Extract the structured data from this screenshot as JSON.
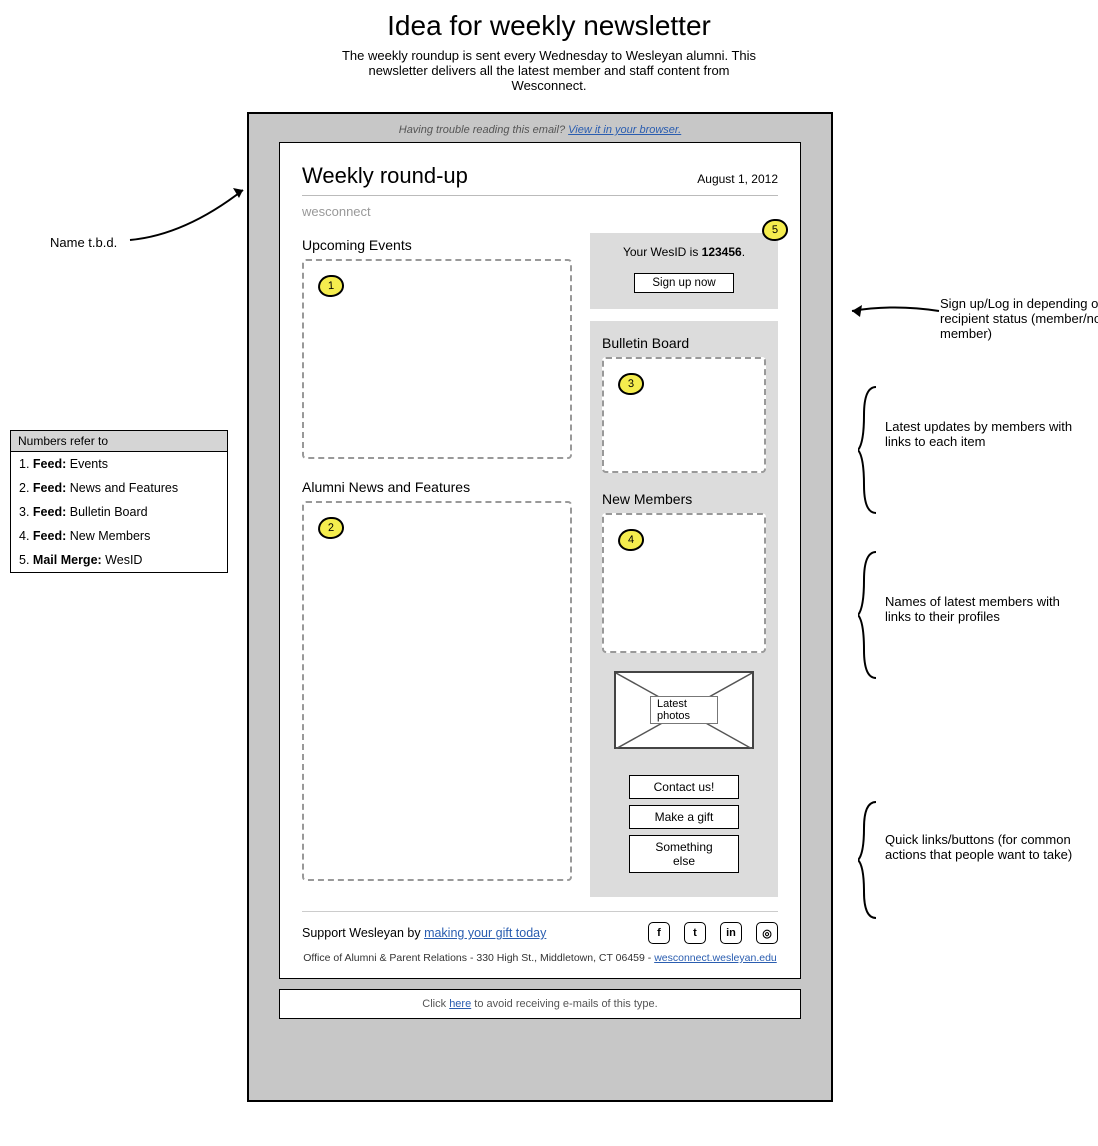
{
  "page": {
    "title": "Idea for weekly newsletter",
    "subtitle": "The weekly roundup is sent every Wednesday to Wesleyan alumni. This newsletter delivers all the latest member and staff content from Wesconnect."
  },
  "trouble": {
    "prefix": "Having trouble reading this email? ",
    "link": "View it in your browser."
  },
  "header": {
    "title": "Weekly round-up",
    "date": "August 1, 2012",
    "brand": "wesconnect"
  },
  "sections": {
    "events": "Upcoming Events",
    "news": "Alumni News and Features",
    "bulletin": "Bulletin Board",
    "members": "New Members",
    "photos": "Latest photos"
  },
  "wesid": {
    "prefix": "Your WesID is ",
    "value": "123456",
    "suffix": ".",
    "signup": "Sign up now"
  },
  "actions": {
    "contact": "Contact us!",
    "gift": "Make a gift",
    "other": "Something else"
  },
  "footer": {
    "support_prefix": "Support Wesleyan by ",
    "support_link": "making your gift today",
    "address": "Office of Alumni & Parent Relations - 330 High St., Middletown, CT 06459 - ",
    "address_link": "wesconnect.wesleyan.edu"
  },
  "unsub": {
    "prefix": "Click ",
    "link": "here",
    "suffix": " to avoid receiving e-mails of this type."
  },
  "annot": {
    "name": "Name t.b.d.",
    "signup": "Sign up/Log in depending on recipient status (member/non-member)",
    "bulletin": "Latest updates by members with links to each item",
    "members": "Names of latest members with links to their profiles",
    "actions": "Quick links/buttons (for common actions that people want to take)"
  },
  "legend": {
    "title": "Numbers refer to",
    "items": [
      {
        "n": "1.",
        "label": "Feed:",
        "val": "Events"
      },
      {
        "n": "2.",
        "label": "Feed:",
        "val": "News and Features"
      },
      {
        "n": "3.",
        "label": "Feed:",
        "val": "Bulletin Board"
      },
      {
        "n": "4.",
        "label": "Feed:",
        "val": "New Members"
      },
      {
        "n": "5.",
        "label": "Mail Merge:",
        "val": "WesID"
      }
    ]
  },
  "markers": {
    "m1": "1",
    "m2": "2",
    "m3": "3",
    "m4": "4",
    "m5": "5"
  },
  "social": {
    "fb": "f",
    "tw": "t",
    "li": "in",
    "ig": "◎"
  }
}
